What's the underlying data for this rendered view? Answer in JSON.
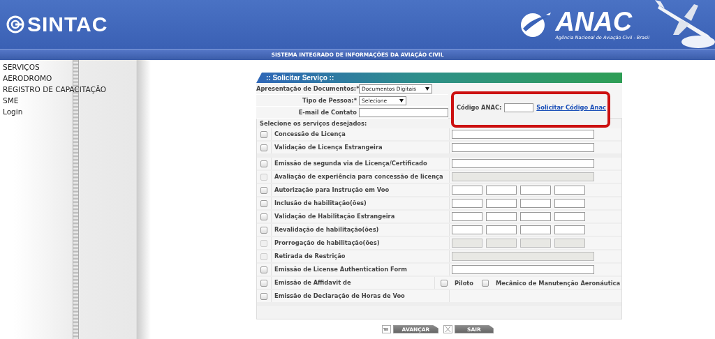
{
  "header": {
    "app_name": "SINTAC",
    "agency_name": "ANAC",
    "agency_subtitle": "Agência Nacional de Aviação Civil - Brasil",
    "system_title": "SISTEMA INTEGRADO DE INFORMAÇÕES DA AVIAÇÃO CIVIL"
  },
  "sidebar": {
    "items": [
      "SERVIÇOS",
      "AERODROMO",
      "REGISTRO DE CAPACITAÇÃO",
      "SME",
      "Login"
    ]
  },
  "form": {
    "title": ":: Solicitar Serviço ::",
    "document_presentation": {
      "label": "Apresentação de Documentos:*",
      "value": "Documentos Digitais"
    },
    "person_type": {
      "label": "Tipo de Pessoa:*",
      "value": "Selecione"
    },
    "email": {
      "label": "E-mail de Contato"
    },
    "anac_code": {
      "label": "Código ANAC:",
      "link": "Solicitar Código Anac"
    },
    "services_heading": "Selecione os serviços desejados:",
    "service_groups": [
      {
        "items": [
          {
            "label": "Concessão de Licença",
            "kind": "single",
            "checked": false,
            "disabled": false
          },
          {
            "label": "Validação de Licença Estrangeira",
            "kind": "single",
            "checked": false,
            "disabled": false
          }
        ]
      },
      {
        "items": [
          {
            "label": "Emissão de segunda via de Licença/Certificado",
            "kind": "single",
            "checked": false,
            "disabled": false
          },
          {
            "label": "Avaliação de experiência para concessão de licença",
            "kind": "single",
            "checked": false,
            "disabled": true
          },
          {
            "label": "Autorização para Instrução em Voo",
            "kind": "quad",
            "checked": false,
            "disabled": false
          },
          {
            "label": "Inclusão de habilitação(ões)",
            "kind": "quad",
            "checked": false,
            "disabled": false
          },
          {
            "label": "Validação de Habilitação Estrangeira",
            "kind": "quad",
            "checked": false,
            "disabled": false
          },
          {
            "label": "Revalidação de habilitação(ões)",
            "kind": "quad",
            "checked": false,
            "disabled": false
          },
          {
            "label": "Prorrogação de habilitação(ões)",
            "kind": "quad",
            "checked": false,
            "disabled": true
          },
          {
            "label": "Retirada de Restrição",
            "kind": "single",
            "checked": false,
            "disabled": true
          },
          {
            "label": "Emissão de License Authentication Form",
            "kind": "single",
            "checked": false,
            "disabled": false
          },
          {
            "label": "Emissão de Affidavit de",
            "kind": "options",
            "checked": false,
            "disabled": false,
            "options": [
              {
                "label": "Piloto",
                "checked": false
              },
              {
                "label": "Mecânico de Manutenção Aeronáutica",
                "checked": false
              }
            ]
          },
          {
            "label": "Emissão de Declaração de Horas de Voo",
            "kind": "none",
            "checked": false,
            "disabled": false
          }
        ]
      }
    ]
  },
  "buttons": [
    {
      "label": "AVANÇAR",
      "kind": "next"
    },
    {
      "label": "SAIR",
      "kind": "exit"
    }
  ]
}
